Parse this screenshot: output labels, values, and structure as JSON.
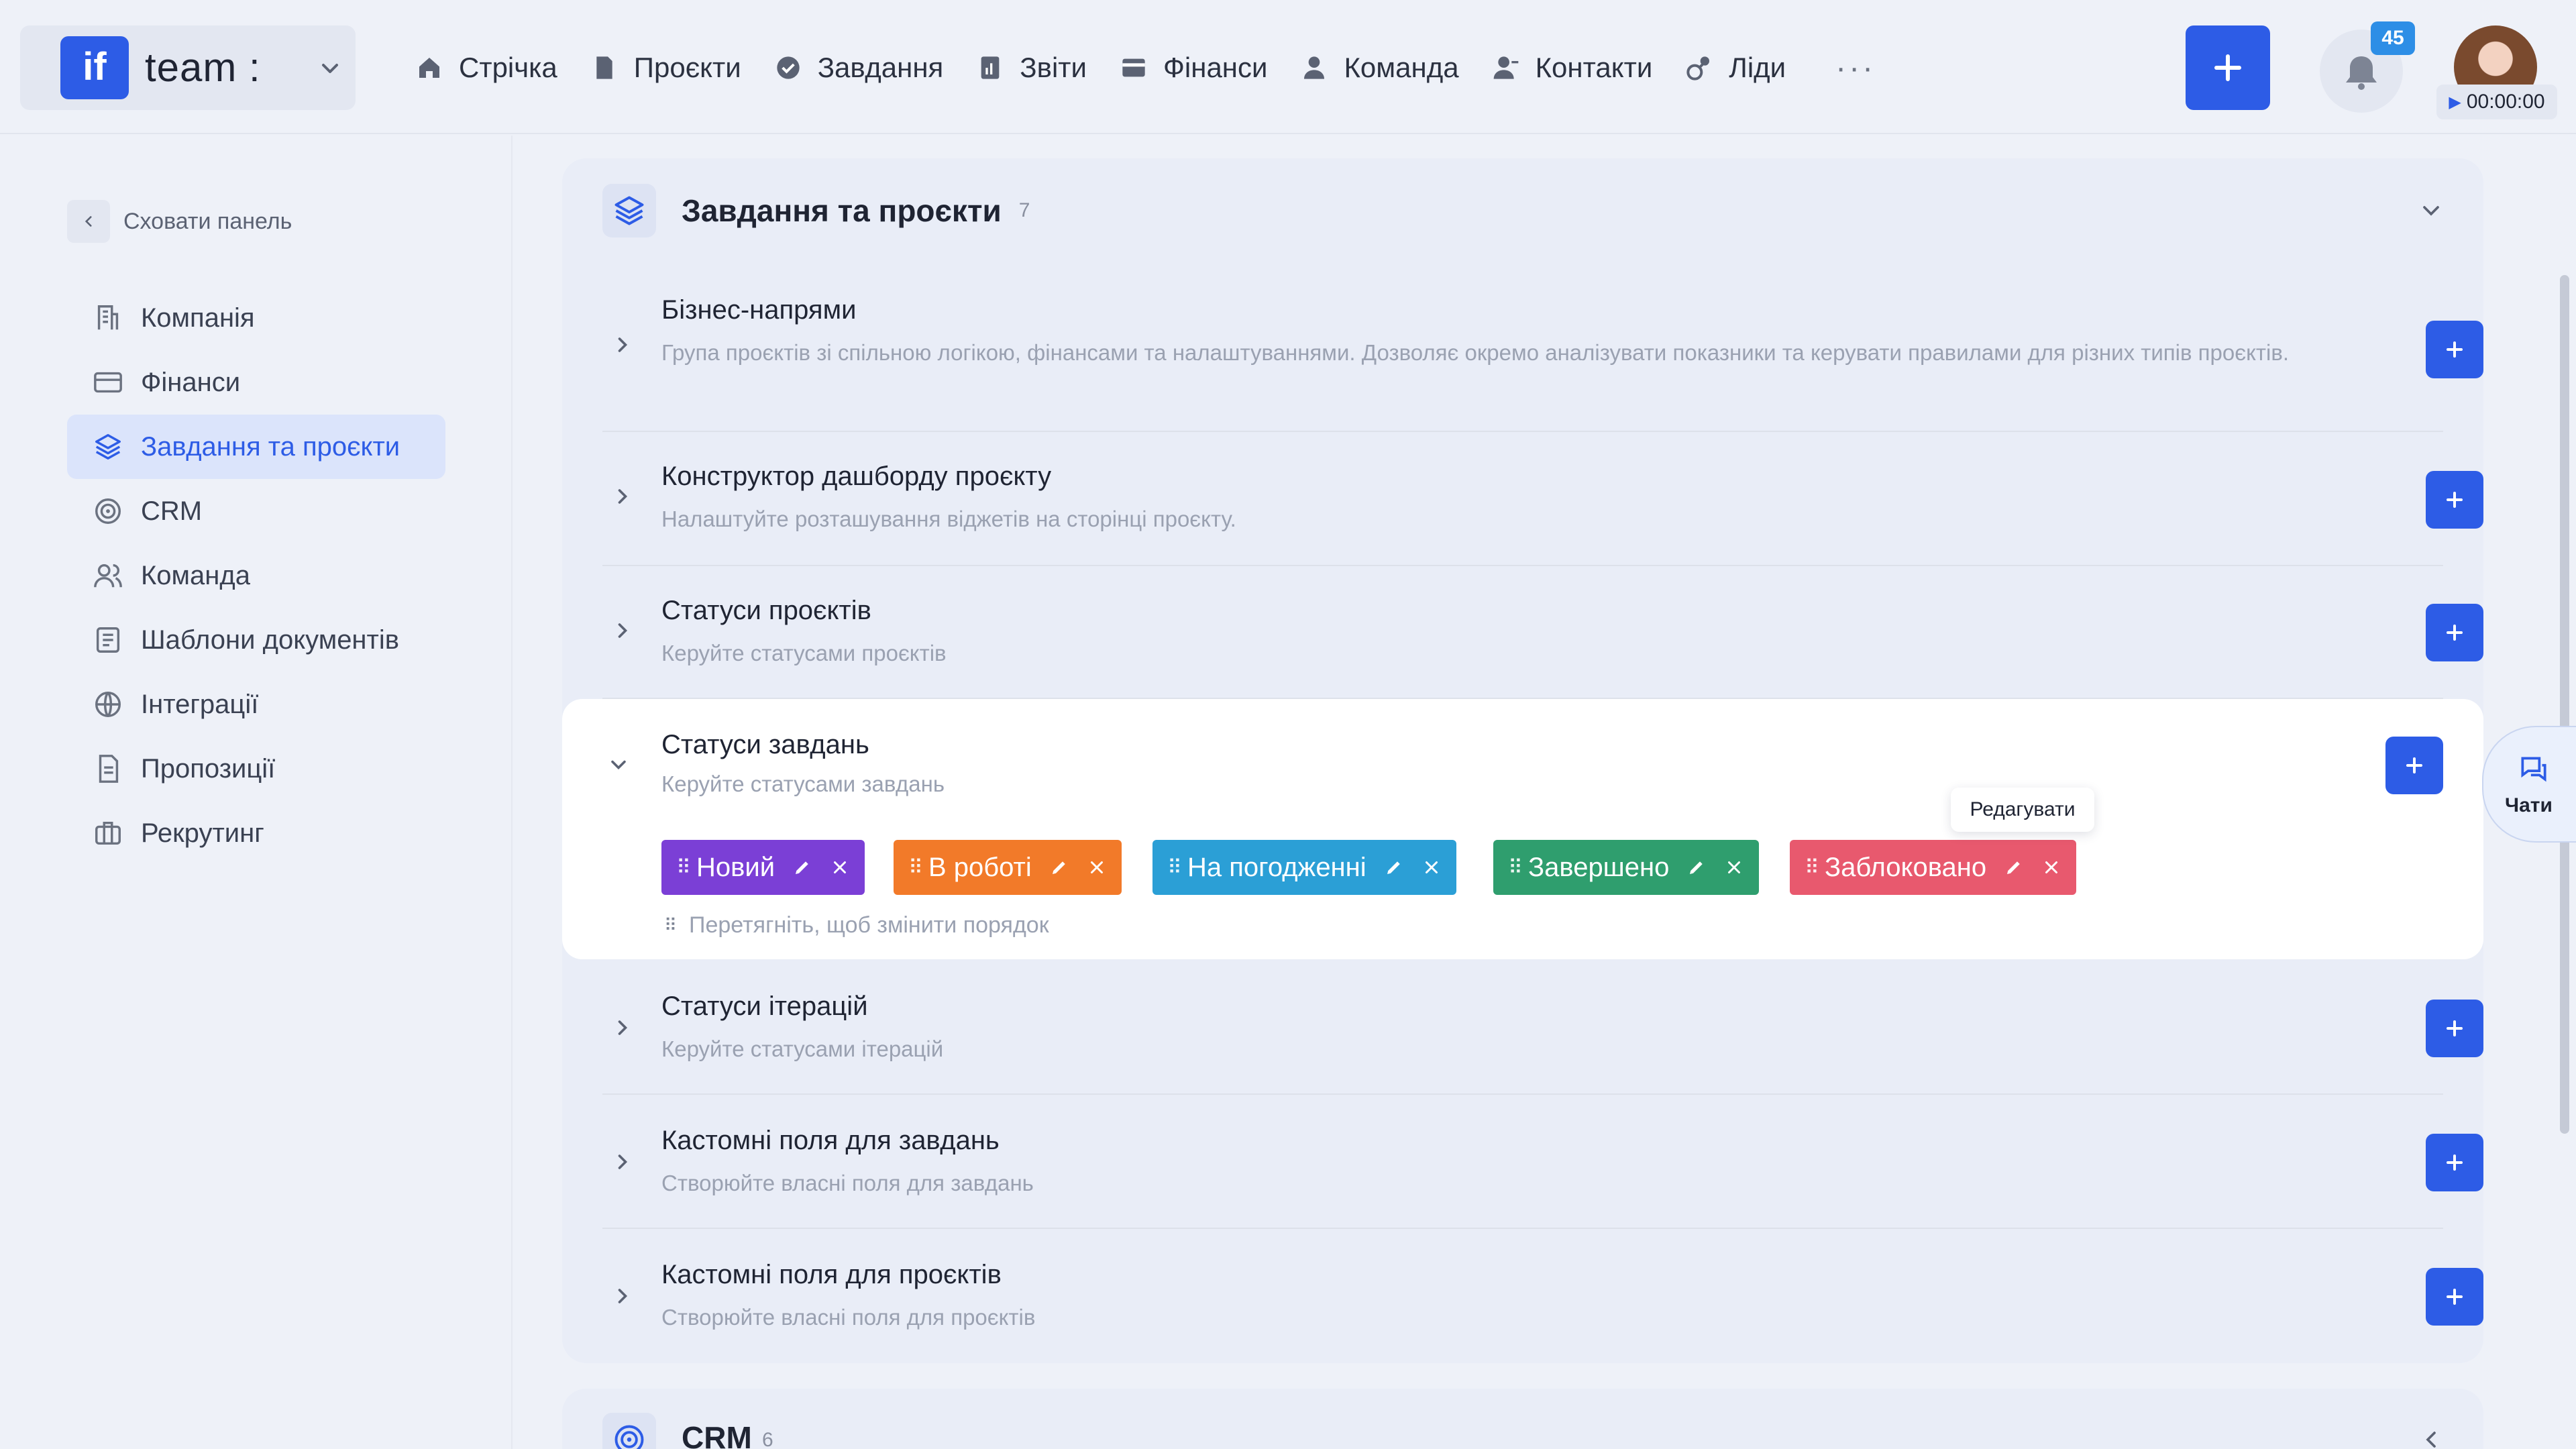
{
  "workspace": {
    "logo": "if",
    "name": "team :"
  },
  "nav": [
    {
      "label": "Стрічка",
      "icon": "home-icon"
    },
    {
      "label": "Проєкти",
      "icon": "file-icon"
    },
    {
      "label": "Завдання",
      "icon": "check-circle-icon"
    },
    {
      "label": "Звіти",
      "icon": "report-icon"
    },
    {
      "label": "Фінанси",
      "icon": "wallet-icon"
    },
    {
      "label": "Команда",
      "icon": "user-icon"
    },
    {
      "label": "Контакти",
      "icon": "contacts-icon"
    },
    {
      "label": "Ліди",
      "icon": "leads-icon"
    }
  ],
  "nav_more": "···",
  "notifications": {
    "count": "45"
  },
  "timer": {
    "value": "00:00:00"
  },
  "sidebar": {
    "hide_label": "Сховати панель",
    "items": [
      {
        "label": "Компанія",
        "icon": "company-icon"
      },
      {
        "label": "Фінанси",
        "icon": "card-icon"
      },
      {
        "label": "Завдання та проєкти",
        "icon": "layers-icon",
        "active": true
      },
      {
        "label": "CRM",
        "icon": "target-icon"
      },
      {
        "label": "Команда",
        "icon": "team-icon"
      },
      {
        "label": "Шаблони документів",
        "icon": "template-icon"
      },
      {
        "label": "Інтеграції",
        "icon": "globe-icon"
      },
      {
        "label": "Пропозиції",
        "icon": "document-icon"
      },
      {
        "label": "Рекрутинг",
        "icon": "briefcase-icon"
      }
    ]
  },
  "main": {
    "section_title": "Завдання та проєкти",
    "section_count": "7",
    "rows": [
      {
        "title": "Бізнес-напрями",
        "desc": "Група проєктів зі спільною логікою, фінансами та налаштуваннями. Дозволяє окремо аналізувати показники та керувати правилами для різних типів проєктів."
      },
      {
        "title": "Конструктор дашборду проєкту",
        "desc": "Налаштуйте розташування віджетів на сторінці проєкту."
      },
      {
        "title": "Статуси проєктів",
        "desc": "Керуйте статусами проєктів"
      },
      {
        "title": "Статуси завдань",
        "desc": "Керуйте статусами завдань",
        "expanded": true
      },
      {
        "title": "Статуси ітерацій",
        "desc": "Керуйте статусами ітерацій"
      },
      {
        "title": "Кастомні поля для завдань",
        "desc": "Створюйте власні поля для завдань"
      },
      {
        "title": "Кастомні поля для проєктів",
        "desc": "Створюйте власні поля для проєктів"
      }
    ],
    "task_statuses": [
      {
        "label": "Новий",
        "color": "#7b3fd6"
      },
      {
        "label": "В роботі",
        "color": "#f27a29"
      },
      {
        "label": "На погодженні",
        "color": "#2b9fd6"
      },
      {
        "label": "Завершено",
        "color": "#2f9e6e"
      },
      {
        "label": "Заблоковано",
        "color": "#e8596e"
      }
    ],
    "drag_hint": "Перетягніть, щоб змінити порядок",
    "tooltip": "Редагувати",
    "next_section_title": "CRM",
    "next_section_count": "6"
  },
  "chats": {
    "label": "Чати"
  },
  "colors": {
    "accent": "#2d5ce6",
    "background": "#eef1f8"
  }
}
